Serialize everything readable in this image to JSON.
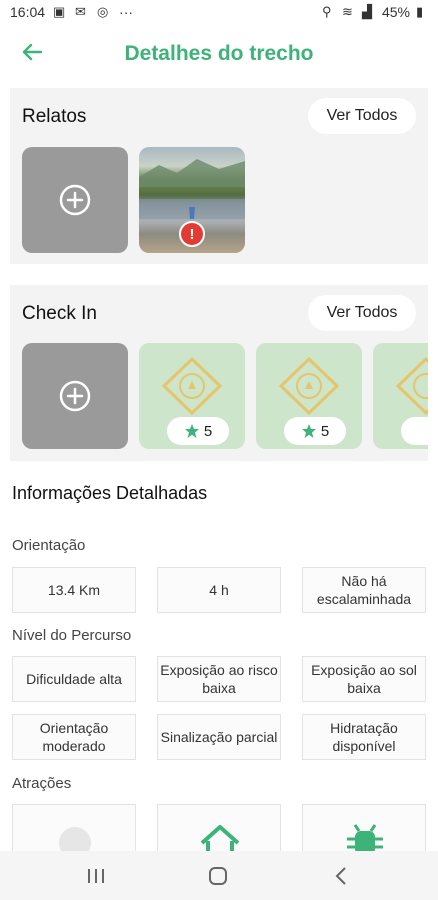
{
  "status_bar": {
    "time": "16:04",
    "dots": "···",
    "battery": "45%"
  },
  "header": {
    "title": "Detalhes do trecho"
  },
  "relatos": {
    "title": "Relatos",
    "see_all": "Ver Todos",
    "alert_icon": "!"
  },
  "checkin": {
    "title": "Check In",
    "see_all": "Ver Todos",
    "items": [
      {
        "rating": "5"
      },
      {
        "rating": "5"
      }
    ]
  },
  "details": {
    "title": "Informações Detalhadas",
    "orientation_label": "Orientação",
    "orientation_items": [
      "13.4 Km",
      "4 h",
      "Não há escalaminhada"
    ],
    "level_label": "Nível do Percurso",
    "level_items": [
      "Dificuldade alta",
      "Exposição ao risco baixa",
      "Exposição ao sol baixa",
      "Orientação moderado",
      "Sinalização parcial",
      "Hidratação disponível"
    ],
    "attractions_label": "Atrações"
  },
  "colors": {
    "accent": "#3db37a",
    "card_bg": "#f3f3f3",
    "checkin_bg": "#cde6cb",
    "add_tile": "#9a9a9a",
    "alert": "#e33b34"
  }
}
